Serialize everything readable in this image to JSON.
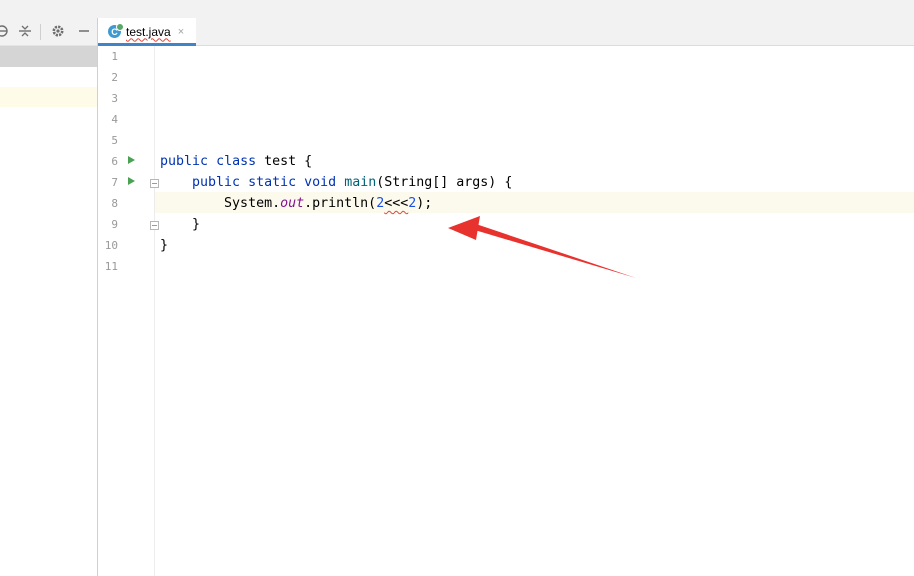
{
  "editor": {
    "tab": {
      "label": "test.java",
      "icon_letter": "C",
      "close": "×"
    },
    "line_numbers": [
      "1",
      "2",
      "3",
      "4",
      "5",
      "6",
      "7",
      "8",
      "9",
      "10",
      "11"
    ],
    "code": {
      "line6": {
        "kw1": "public",
        "kw2": "class",
        "name": "test",
        "brace": "{"
      },
      "line7": {
        "kw1": "public",
        "kw2": "static",
        "kw3": "void",
        "method": "main",
        "params_open": "(String[] args) {"
      },
      "line8": {
        "obj": "System.",
        "field": "out",
        "call": ".println(",
        "num1": "2",
        "op": "<<<",
        "num2": "2",
        "end": ");"
      },
      "line9": {
        "brace": "}"
      },
      "line10": {
        "brace": "}"
      }
    }
  },
  "annotation": {
    "arrow_color": "#e8322e"
  },
  "colors": {
    "keyword": "#0033b3",
    "method": "#00627a",
    "static_field": "#871094",
    "number": "#1750eb",
    "run_icon": "#4aa252",
    "tab_accent": "#4083c9"
  }
}
